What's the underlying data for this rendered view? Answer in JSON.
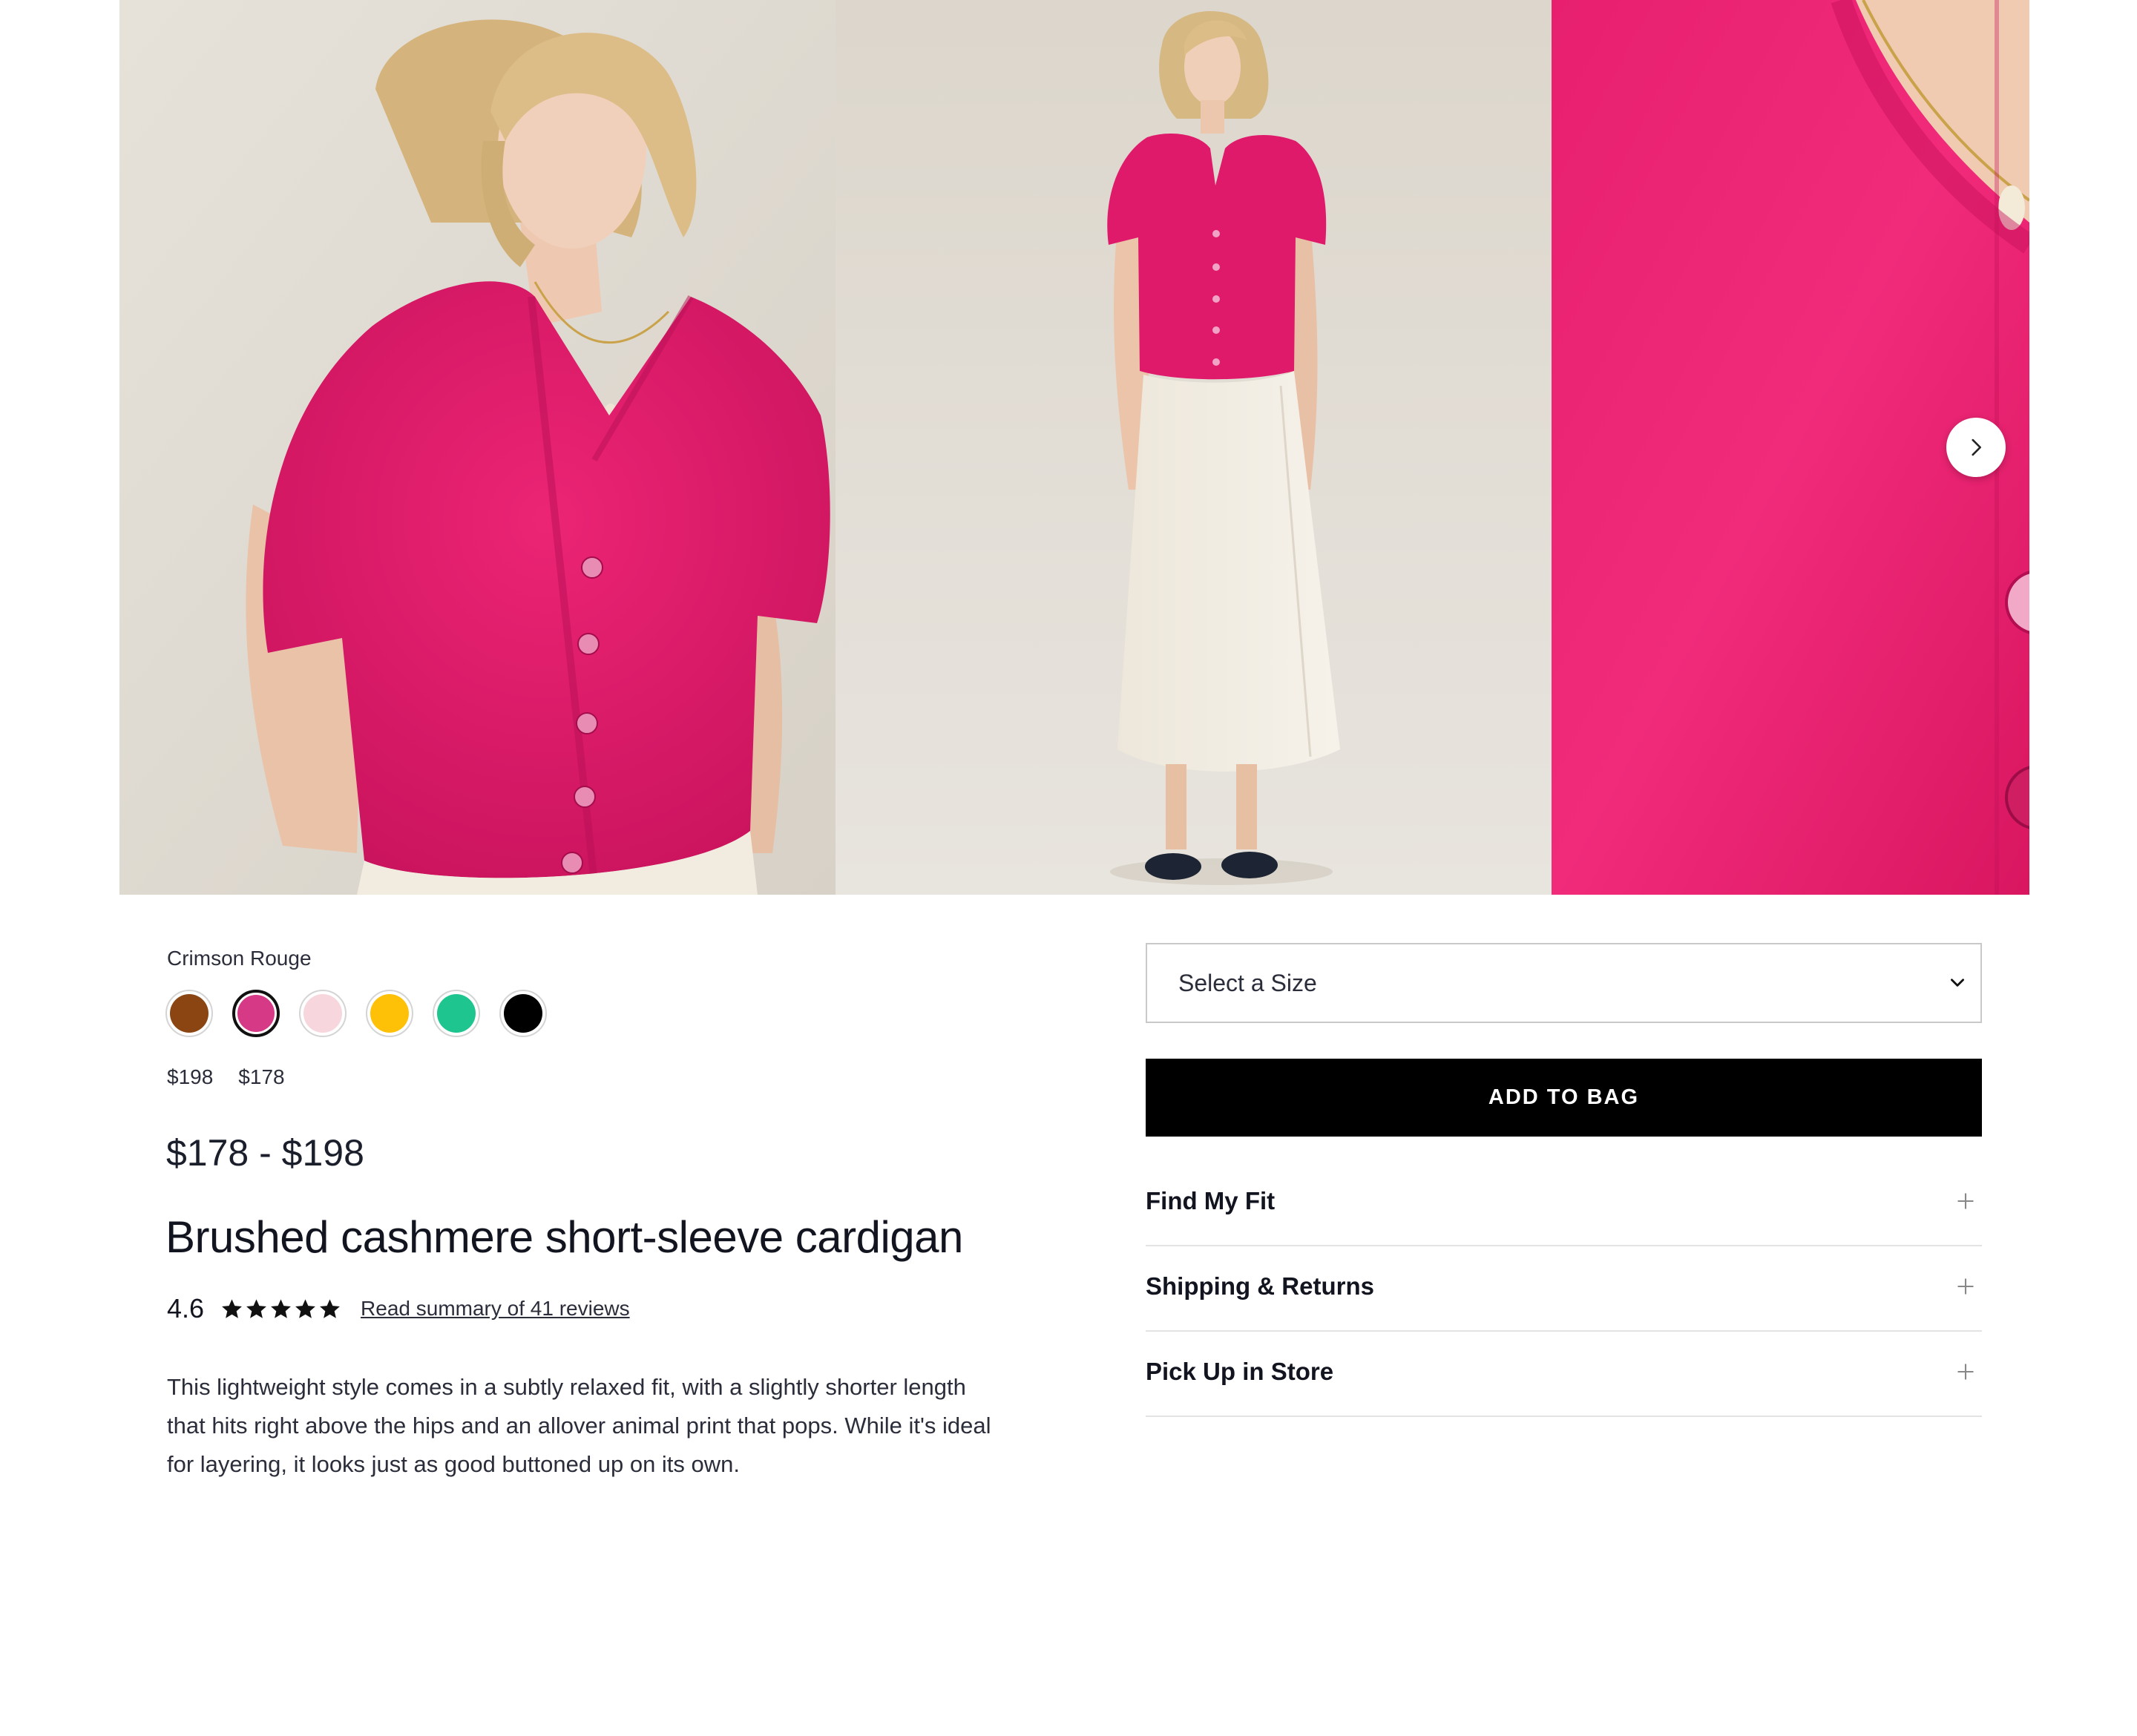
{
  "gallery": {
    "images": [
      {
        "alt": "",
        "icon": "product-photo-model-closeup"
      },
      {
        "alt": "",
        "icon": "product-photo-model-full-length"
      },
      {
        "alt": "",
        "icon": "product-photo-fabric-detail"
      }
    ],
    "next_icon": "chevron-right-icon"
  },
  "product": {
    "color_name": "Crimson Rouge",
    "swatches": [
      {
        "color": "#8B4513",
        "selected": false
      },
      {
        "color": "#D63A86",
        "selected": true
      },
      {
        "color": "#F7D6DE",
        "selected": false
      },
      {
        "color": "#FFC107",
        "selected": false
      },
      {
        "color": "#1FC58F",
        "selected": false
      },
      {
        "color": "#000000",
        "selected": false
      }
    ],
    "swatch_prices": [
      "$198",
      "$178"
    ],
    "price_range": "$178 - $198",
    "title": "Brushed cashmere short-sleeve cardigan",
    "rating": {
      "value": "4.6",
      "stars": 5,
      "reviews_link": "Read summary of 41 reviews"
    },
    "description": "This lightweight style comes in a subtly relaxed fit, with a slightly shorter length that hits right above the hips and an allover animal print that pops. While it's ideal for layering, it looks just as good buttoned up on its own."
  },
  "purchase": {
    "size_select_placeholder": "Select a Size",
    "add_to_bag_label": "ADD TO BAG",
    "accordion": [
      {
        "label": "Find My Fit",
        "icon": "plus-icon"
      },
      {
        "label": "Shipping & Returns",
        "icon": "plus-icon"
      },
      {
        "label": "Pick Up in Store",
        "icon": "plus-icon"
      }
    ]
  },
  "colors": {
    "cardigan": "#E0196B",
    "background_warm": "#E0DCD4",
    "button_primary": "#000000",
    "text_primary": "#12141F"
  }
}
